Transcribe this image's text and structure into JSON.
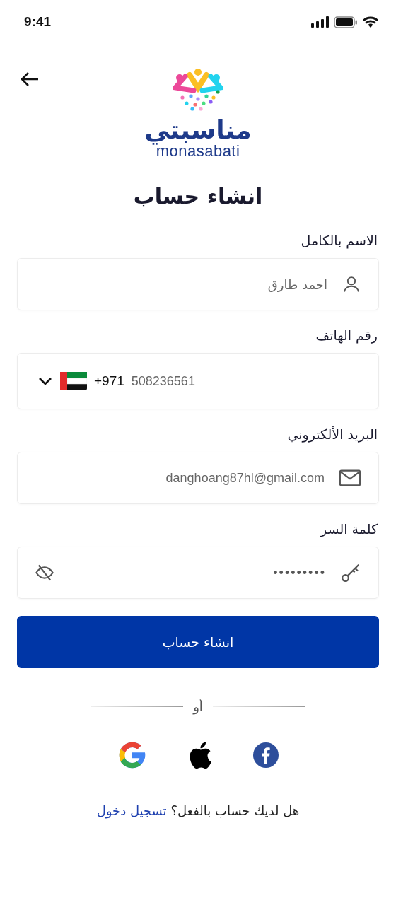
{
  "status_bar": {
    "time": "9:41"
  },
  "logo": {
    "arabic": "مناسبتي",
    "latin": "monasabati"
  },
  "title": "انشاء حساب",
  "fields": [
    {
      "kind": "text",
      "label": "الاسم بالكامل",
      "value": "احمد طارق"
    },
    {
      "kind": "phone",
      "label": "رقم الهاتف",
      "country_code": "+971",
      "value": "508236561"
    },
    {
      "kind": "email",
      "label": "البريد الألكتروني",
      "value": "danghoang87hl@gmail.com"
    },
    {
      "kind": "password",
      "label": "كلمة السر",
      "value": "•••••••••"
    }
  ],
  "submit_button": "انشاء حساب",
  "divider_text": "أو",
  "footer": {
    "question": "هل لديك حساب بالفعل؟",
    "link": "تسجيل دخول"
  }
}
